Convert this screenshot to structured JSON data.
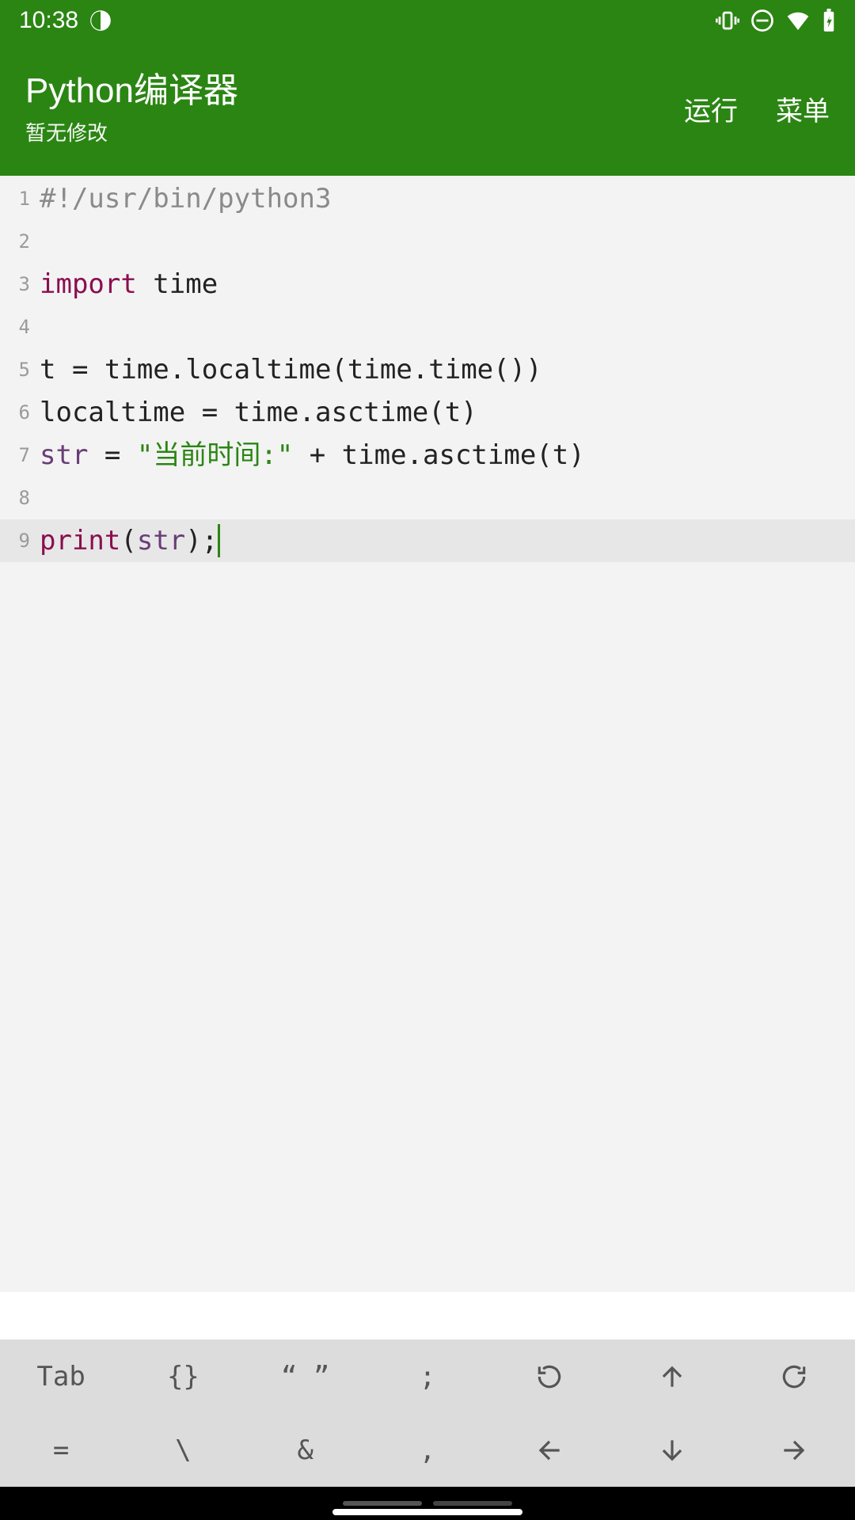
{
  "status": {
    "time": "10:38"
  },
  "header": {
    "title": "Python编译器",
    "subtitle": "暂无修改",
    "run": "运行",
    "menu": "菜单"
  },
  "code": {
    "l1_shebang": "#!/usr/bin/python3",
    "l3_kw": "import",
    "l3_rest": " time",
    "l5": "t = time.localtime(time.time())",
    "l6": "localtime = time.asctime(t)",
    "l7_var": "str",
    "l7_eq": " = ",
    "l7_str": "\"当前时间:\"",
    "l7_rest": " + time.asctime(t)",
    "l9_fn": "print",
    "l9_p1": "(",
    "l9_arg": "str",
    "l9_p2": ");"
  },
  "keys": {
    "r1": {
      "tab": "Tab",
      "braces": "{}",
      "quotes": "“ ”",
      "semi": ";"
    },
    "r2": {
      "eq": "=",
      "bslash": "\\",
      "amp": "&",
      "comma": ","
    }
  },
  "gutter": [
    "1",
    "2",
    "3",
    "4",
    "5",
    "6",
    "7",
    "8",
    "9"
  ]
}
